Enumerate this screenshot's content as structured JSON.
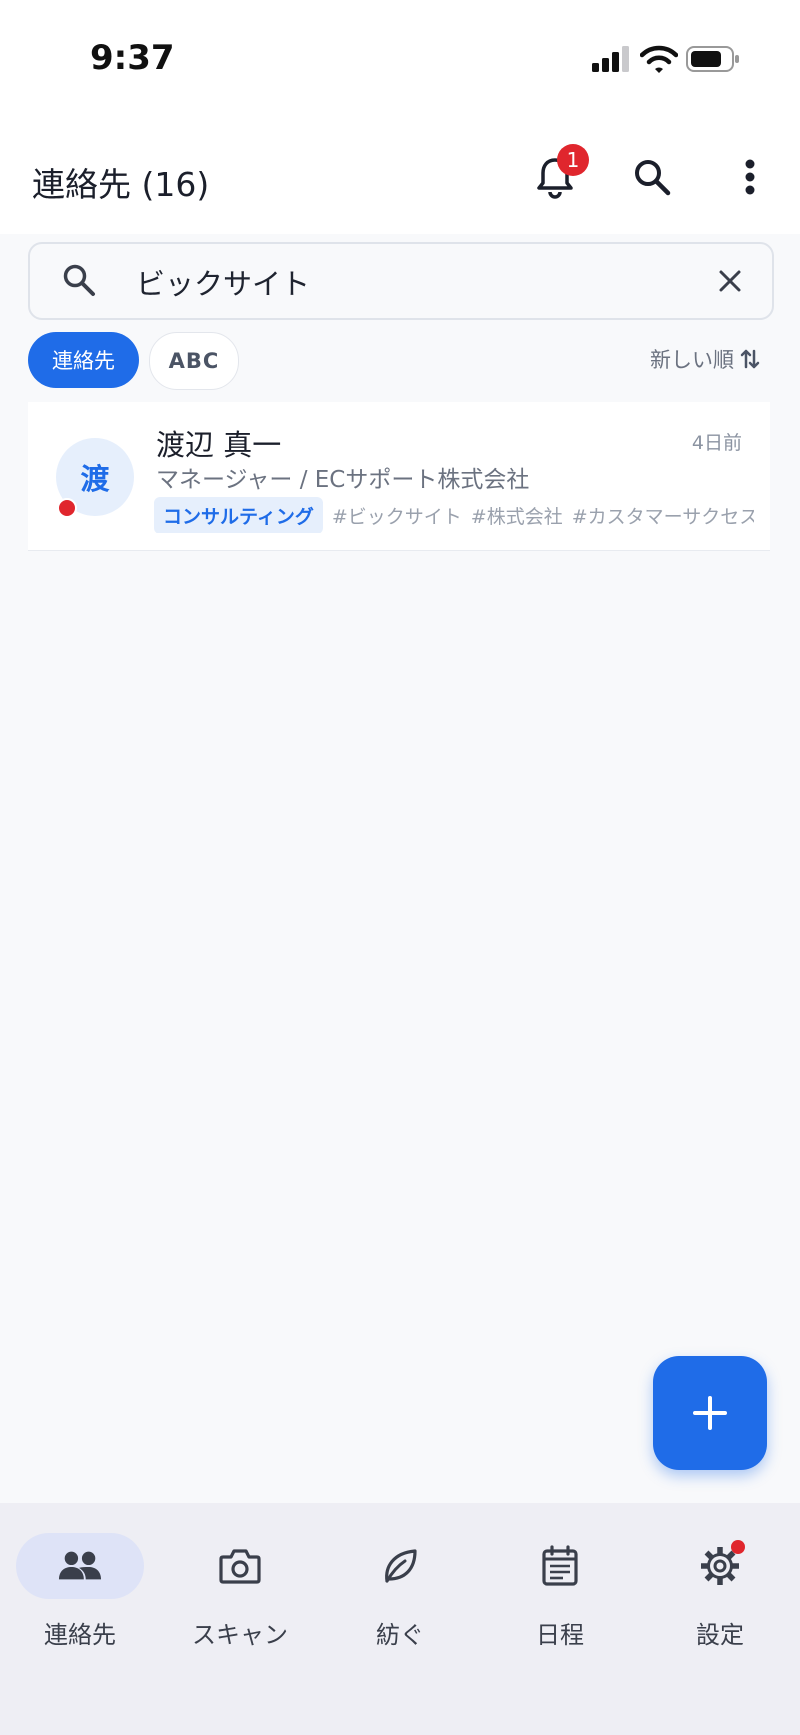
{
  "status_bar": {
    "time": "9:37"
  },
  "header": {
    "title": "連絡先 (16)",
    "notification_count": "1"
  },
  "search": {
    "value": "ビックサイト",
    "placeholder": ""
  },
  "filters": {
    "chips": [
      "連絡先",
      "ABC"
    ],
    "sort_label": "新しい順"
  },
  "contacts": [
    {
      "avatar_initial": "渡",
      "name": "渡辺 真一",
      "time_ago": "4日前",
      "role": "マネージャー / ECサポート株式会社",
      "primary_tag": "コンサルティング",
      "tags": [
        "#ビックサイト",
        "#株式会社",
        "#カスタマーサクセス"
      ]
    }
  ],
  "fab": {
    "icon": "plus-icon"
  },
  "bottom_nav": {
    "items": [
      {
        "label": "連絡先",
        "icon": "people-icon",
        "active": true
      },
      {
        "label": "スキャン",
        "icon": "camera-icon"
      },
      {
        "label": "紡ぐ",
        "icon": "leaf-icon"
      },
      {
        "label": "日程",
        "icon": "calendar-icon"
      },
      {
        "label": "設定",
        "icon": "gear-icon",
        "has_dot": true
      }
    ]
  },
  "colors": {
    "accent": "#1f6ce8",
    "alert": "#e0262d",
    "nav_background": "#eeeef4"
  }
}
